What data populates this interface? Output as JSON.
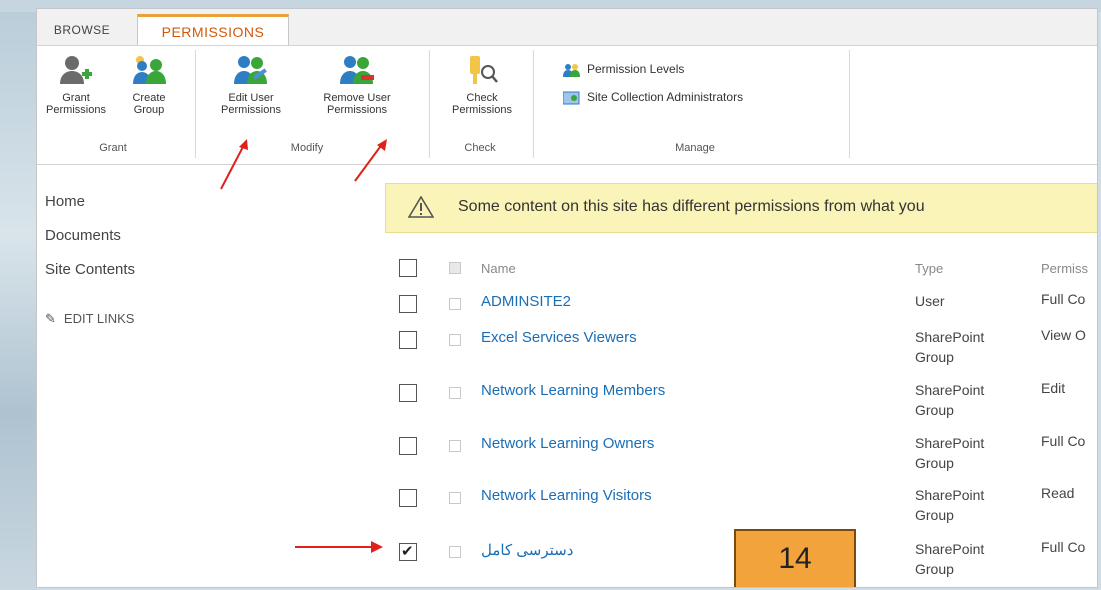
{
  "tabs": {
    "browse": "BROWSE",
    "permissions": "PERMISSIONS"
  },
  "ribbon": {
    "grant": {
      "label": "Grant",
      "grant_permissions": [
        "Grant",
        "Permissions"
      ],
      "create_group": [
        "Create",
        "Group"
      ]
    },
    "modify": {
      "label": "Modify",
      "edit_user_permissions": [
        "Edit User",
        "Permissions"
      ],
      "remove_user_permissions": [
        "Remove User",
        "Permissions"
      ]
    },
    "check": {
      "label": "Check",
      "check_permissions": [
        "Check",
        "Permissions"
      ]
    },
    "manage": {
      "label": "Manage",
      "permission_levels": "Permission Levels",
      "site_collection_admins": "Site Collection Administrators"
    }
  },
  "nav": {
    "home": "Home",
    "documents": "Documents",
    "site_contents": "Site Contents",
    "edit_links": "EDIT LINKS"
  },
  "warning": "Some content on this site has different permissions from what you",
  "table": {
    "headers": {
      "name": "Name",
      "type": "Type",
      "permissions": "Permiss"
    },
    "rows": [
      {
        "name": "ADMINSITE2",
        "type": [
          "User"
        ],
        "permission": "Full Co",
        "checked": false
      },
      {
        "name": "Excel Services Viewers",
        "type": [
          "SharePoint",
          "Group"
        ],
        "permission": "View O",
        "checked": false
      },
      {
        "name": "Network Learning Members",
        "type": [
          "SharePoint",
          "Group"
        ],
        "permission": "Edit",
        "checked": false
      },
      {
        "name": "Network Learning Owners",
        "type": [
          "SharePoint",
          "Group"
        ],
        "permission": "Full Co",
        "checked": false
      },
      {
        "name": "Network Learning Visitors",
        "type": [
          "SharePoint",
          "Group"
        ],
        "permission": "Read",
        "checked": false
      },
      {
        "name": "دسترسی کامل",
        "type": [
          "SharePoint",
          "Group"
        ],
        "permission": "Full Co",
        "checked": true
      }
    ]
  },
  "badge": "14",
  "colors": {
    "accent": "#d3590a",
    "link": "#1a6eb6",
    "warning_bg": "#fbf4b8",
    "badge": "#f2a33b",
    "arrow": "#e0201b"
  }
}
